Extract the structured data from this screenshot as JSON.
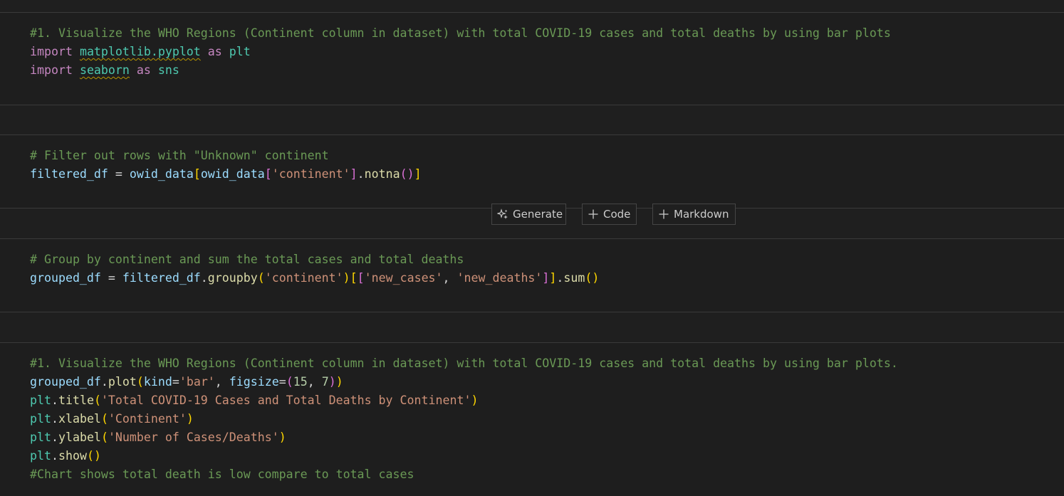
{
  "cells": [
    {
      "lines": [
        [
          {
            "t": "#1. Visualize the WHO Regions (Continent column in dataset) with total COVID-19 cases and total deaths by using bar plots",
            "c": "cm"
          }
        ],
        [
          {
            "t": "import",
            "c": "kw"
          },
          {
            "t": " "
          },
          {
            "t": "matplotlib.pyplot",
            "c": "mod squig"
          },
          {
            "t": " "
          },
          {
            "t": "as",
            "c": "kw"
          },
          {
            "t": " "
          },
          {
            "t": "plt",
            "c": "mod"
          }
        ],
        [
          {
            "t": "import",
            "c": "kw"
          },
          {
            "t": " "
          },
          {
            "t": "seaborn",
            "c": "mod squig"
          },
          {
            "t": " "
          },
          {
            "t": "as",
            "c": "kw"
          },
          {
            "t": " "
          },
          {
            "t": "sns",
            "c": "mod"
          }
        ]
      ]
    },
    {
      "lines": [
        [
          {
            "t": "# Filter out rows with \"Unknown\" continent",
            "c": "cm"
          }
        ],
        [
          {
            "t": "filtered_df",
            "c": "var"
          },
          {
            "t": " = "
          },
          {
            "t": "owid_data",
            "c": "var"
          },
          {
            "t": "[",
            "c": "b1"
          },
          {
            "t": "owid_data",
            "c": "var"
          },
          {
            "t": "[",
            "c": "b2"
          },
          {
            "t": "'continent'",
            "c": "str"
          },
          {
            "t": "]",
            "c": "b2"
          },
          {
            "t": "."
          },
          {
            "t": "notna",
            "c": "fn"
          },
          {
            "t": "()",
            "c": "b2"
          },
          {
            "t": "]",
            "c": "b1"
          }
        ]
      ]
    },
    {
      "lines": [
        [
          {
            "t": "# Group by continent and sum the total cases and total deaths",
            "c": "cm"
          }
        ],
        [
          {
            "t": "grouped_df",
            "c": "var"
          },
          {
            "t": " = "
          },
          {
            "t": "filtered_df",
            "c": "var"
          },
          {
            "t": "."
          },
          {
            "t": "groupby",
            "c": "fn"
          },
          {
            "t": "(",
            "c": "b1"
          },
          {
            "t": "'continent'",
            "c": "str"
          },
          {
            "t": ")",
            "c": "b1"
          },
          {
            "t": "[",
            "c": "b1"
          },
          {
            "t": "[",
            "c": "b2"
          },
          {
            "t": "'new_cases'",
            "c": "str"
          },
          {
            "t": ", "
          },
          {
            "t": "'new_deaths'",
            "c": "str"
          },
          {
            "t": "]",
            "c": "b2"
          },
          {
            "t": "]",
            "c": "b1"
          },
          {
            "t": "."
          },
          {
            "t": "sum",
            "c": "fn"
          },
          {
            "t": "()",
            "c": "b1"
          }
        ]
      ]
    },
    {
      "lines": [
        [
          {
            "t": "#1. Visualize the WHO Regions (Continent column in dataset) with total COVID-19 cases and total deaths by using bar plots.",
            "c": "cm"
          }
        ],
        [
          {
            "t": "grouped_df",
            "c": "var"
          },
          {
            "t": "."
          },
          {
            "t": "plot",
            "c": "fn"
          },
          {
            "t": "(",
            "c": "b1"
          },
          {
            "t": "kind",
            "c": "var"
          },
          {
            "t": "="
          },
          {
            "t": "'bar'",
            "c": "str"
          },
          {
            "t": ", "
          },
          {
            "t": "figsize",
            "c": "var"
          },
          {
            "t": "="
          },
          {
            "t": "(",
            "c": "b2"
          },
          {
            "t": "15",
            "c": "num"
          },
          {
            "t": ", "
          },
          {
            "t": "7",
            "c": "num"
          },
          {
            "t": ")",
            "c": "b2"
          },
          {
            "t": ")",
            "c": "b1"
          }
        ],
        [
          {
            "t": "plt",
            "c": "mod"
          },
          {
            "t": "."
          },
          {
            "t": "title",
            "c": "fn"
          },
          {
            "t": "(",
            "c": "b1"
          },
          {
            "t": "'Total COVID-19 Cases and Total Deaths by Continent'",
            "c": "str"
          },
          {
            "t": ")",
            "c": "b1"
          }
        ],
        [
          {
            "t": "plt",
            "c": "mod"
          },
          {
            "t": "."
          },
          {
            "t": "xlabel",
            "c": "fn"
          },
          {
            "t": "(",
            "c": "b1"
          },
          {
            "t": "'Continent'",
            "c": "str"
          },
          {
            "t": ")",
            "c": "b1"
          }
        ],
        [
          {
            "t": "plt",
            "c": "mod"
          },
          {
            "t": "."
          },
          {
            "t": "ylabel",
            "c": "fn"
          },
          {
            "t": "(",
            "c": "b1"
          },
          {
            "t": "'Number of Cases/Deaths'",
            "c": "str"
          },
          {
            "t": ")",
            "c": "b1"
          }
        ],
        [
          {
            "t": "plt",
            "c": "mod"
          },
          {
            "t": "."
          },
          {
            "t": "show",
            "c": "fn"
          },
          {
            "t": "()",
            "c": "b1"
          }
        ],
        [
          {
            "t": "#Chart shows total death is low compare to total cases",
            "c": "cm"
          }
        ]
      ]
    }
  ],
  "toolbar": {
    "generate_label": "Generate",
    "code_label": "Code",
    "markdown_label": "Markdown",
    "generate_icon": "sparkle-icon",
    "add_icon": "plus-icon"
  },
  "colors": {
    "comment": "#6a9955",
    "keyword": "#c586c0",
    "module": "#4ec9b0",
    "variable": "#9cdcfe",
    "function": "#dcdcaa",
    "string": "#ce9178",
    "number": "#b5cea8",
    "bracket1": "#ffd700",
    "bracket2": "#da70d6",
    "background": "#1e1e1e"
  }
}
